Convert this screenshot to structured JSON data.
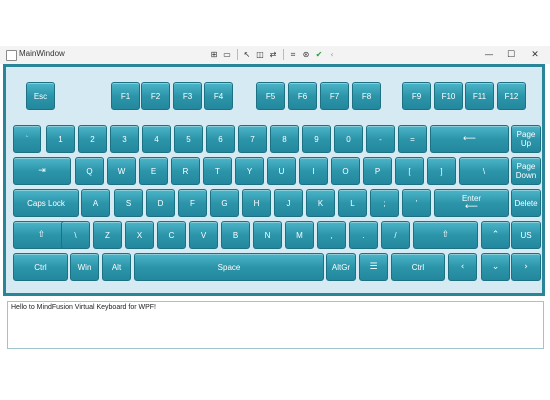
{
  "window": {
    "title": "MainWindow",
    "debug_toolbar_icons": [
      "live-tree-icon",
      "select-element-icon",
      "display-layout-adorners-icon",
      "track-focus-icon",
      "binding-failures-icon",
      "accessibility-icon",
      "hot-reload-icon",
      "collapse-toolbar-icon"
    ],
    "controls": {
      "minimize": "—",
      "maximize": "☐",
      "close": "✕"
    }
  },
  "keyboard": {
    "rows": [
      [
        {
          "id": "esc",
          "label": "Esc"
        },
        {
          "id": "f1",
          "label": "F1"
        },
        {
          "id": "f2",
          "label": "F2"
        },
        {
          "id": "f3",
          "label": "F3"
        },
        {
          "id": "f4",
          "label": "F4"
        },
        {
          "id": "f5",
          "label": "F5"
        },
        {
          "id": "f6",
          "label": "F6"
        },
        {
          "id": "f7",
          "label": "F7"
        },
        {
          "id": "f8",
          "label": "F8"
        },
        {
          "id": "f9",
          "label": "F9"
        },
        {
          "id": "f10",
          "label": "F10"
        },
        {
          "id": "f11",
          "label": "F11"
        },
        {
          "id": "f12",
          "label": "F12"
        }
      ],
      [
        {
          "id": "backtick",
          "label": "`"
        },
        {
          "id": "1",
          "label": "1"
        },
        {
          "id": "2",
          "label": "2"
        },
        {
          "id": "3",
          "label": "3"
        },
        {
          "id": "4",
          "label": "4"
        },
        {
          "id": "5",
          "label": "5"
        },
        {
          "id": "6",
          "label": "6"
        },
        {
          "id": "7",
          "label": "7"
        },
        {
          "id": "8",
          "label": "8"
        },
        {
          "id": "9",
          "label": "9"
        },
        {
          "id": "0",
          "label": "0"
        },
        {
          "id": "minus",
          "label": "-"
        },
        {
          "id": "equals",
          "label": "="
        },
        {
          "id": "backspace",
          "label": "⟵",
          "glyph": true
        },
        {
          "id": "pageup",
          "label": "Page",
          "label2": "Up"
        }
      ],
      [
        {
          "id": "tab",
          "label": "⇥",
          "glyph": true
        },
        {
          "id": "q",
          "label": "Q"
        },
        {
          "id": "w",
          "label": "W"
        },
        {
          "id": "e",
          "label": "E"
        },
        {
          "id": "r",
          "label": "R"
        },
        {
          "id": "t",
          "label": "T"
        },
        {
          "id": "y",
          "label": "Y"
        },
        {
          "id": "u",
          "label": "U"
        },
        {
          "id": "i",
          "label": "I"
        },
        {
          "id": "o",
          "label": "O"
        },
        {
          "id": "p",
          "label": "P"
        },
        {
          "id": "lbracket",
          "label": "["
        },
        {
          "id": "rbracket",
          "label": "]"
        },
        {
          "id": "backslash",
          "label": "\\"
        },
        {
          "id": "pagedown",
          "label": "Page",
          "label2": "Down"
        }
      ],
      [
        {
          "id": "capslock",
          "label": "Caps Lock"
        },
        {
          "id": "a",
          "label": "A"
        },
        {
          "id": "s",
          "label": "S"
        },
        {
          "id": "d",
          "label": "D"
        },
        {
          "id": "f",
          "label": "F"
        },
        {
          "id": "g",
          "label": "G"
        },
        {
          "id": "h",
          "label": "H"
        },
        {
          "id": "j",
          "label": "J"
        },
        {
          "id": "k",
          "label": "K"
        },
        {
          "id": "l",
          "label": "L"
        },
        {
          "id": "semicolon",
          "label": ";"
        },
        {
          "id": "quote",
          "label": "'"
        },
        {
          "id": "enter",
          "label": "Enter",
          "label2": "⟵",
          "glyph2": true
        },
        {
          "id": "delete",
          "label": "Delete"
        }
      ],
      [
        {
          "id": "lshift",
          "label": "⇧",
          "glyph": true
        },
        {
          "id": "oem102",
          "label": "\\"
        },
        {
          "id": "z",
          "label": "Z"
        },
        {
          "id": "x",
          "label": "X"
        },
        {
          "id": "c",
          "label": "C"
        },
        {
          "id": "v",
          "label": "V"
        },
        {
          "id": "b",
          "label": "B"
        },
        {
          "id": "n",
          "label": "N"
        },
        {
          "id": "m",
          "label": "M"
        },
        {
          "id": "comma",
          "label": ","
        },
        {
          "id": "period",
          "label": "."
        },
        {
          "id": "slash",
          "label": "/"
        },
        {
          "id": "rshift",
          "label": "⇧",
          "glyph": true
        },
        {
          "id": "up",
          "label": "⌃",
          "glyph": true
        },
        {
          "id": "layout",
          "label": "US"
        }
      ],
      [
        {
          "id": "lctrl",
          "label": "Ctrl"
        },
        {
          "id": "win",
          "label": "Win"
        },
        {
          "id": "alt",
          "label": "Alt"
        },
        {
          "id": "space",
          "label": "Space"
        },
        {
          "id": "altgr",
          "label": "AltGr"
        },
        {
          "id": "menu",
          "label": "☰",
          "glyph": true
        },
        {
          "id": "rctrl",
          "label": "Ctrl"
        },
        {
          "id": "left",
          "label": "‹",
          "glyph": true
        },
        {
          "id": "down",
          "label": "⌄",
          "glyph": true
        },
        {
          "id": "right",
          "label": "›",
          "glyph": true
        }
      ]
    ]
  },
  "textbox": {
    "value": "Hello to MindFusion Virtual Keyboard for WPF!"
  }
}
